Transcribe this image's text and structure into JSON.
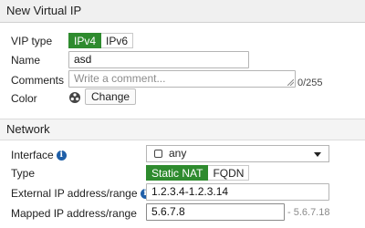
{
  "header": {
    "title": "New Virtual IP"
  },
  "form": {
    "vip_type": {
      "label": "VIP type",
      "options": [
        "IPv4",
        "IPv6"
      ],
      "selected": "IPv4"
    },
    "name": {
      "label": "Name",
      "value": "asd"
    },
    "comments": {
      "label": "Comments",
      "placeholder": "Write a comment...",
      "counter": "0/255"
    },
    "color": {
      "label": "Color",
      "button": "Change"
    }
  },
  "network": {
    "title": "Network",
    "interface": {
      "label": "Interface",
      "value": "any"
    },
    "type": {
      "label": "Type",
      "options": [
        "Static NAT",
        "FQDN"
      ],
      "selected": "Static NAT"
    },
    "external": {
      "label": "External IP address/range",
      "value": "1.2.3.4-1.2.3.14"
    },
    "mapped": {
      "label": "Mapped IP address/range",
      "value": "5.6.7.8",
      "range_hint": "- 5.6.7.18"
    }
  },
  "colors": {
    "accent": "#2e8b2e",
    "info": "#1f5fa8"
  }
}
